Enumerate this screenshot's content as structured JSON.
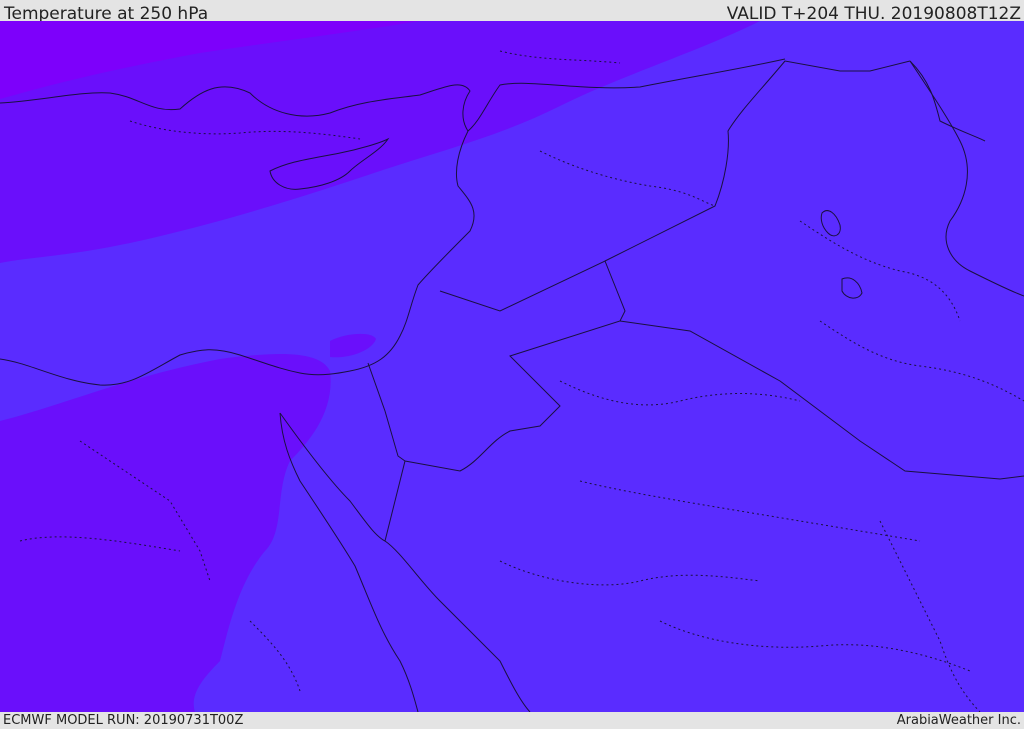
{
  "header": {
    "title": "Temperature at 250 hPa",
    "valid": "VALID T+204 THU. 20190808T12Z"
  },
  "footer": {
    "model_run": "ECMWF MODEL RUN: 20190731T00Z",
    "credit": "ArabiaWeather Inc."
  },
  "map": {
    "colors": {
      "band_coldest": "#7d00fb",
      "band_cold": "#6a0ffb",
      "band_base": "#5a2cff",
      "coastline": "#1a1040",
      "border": "#1a1040"
    }
  }
}
